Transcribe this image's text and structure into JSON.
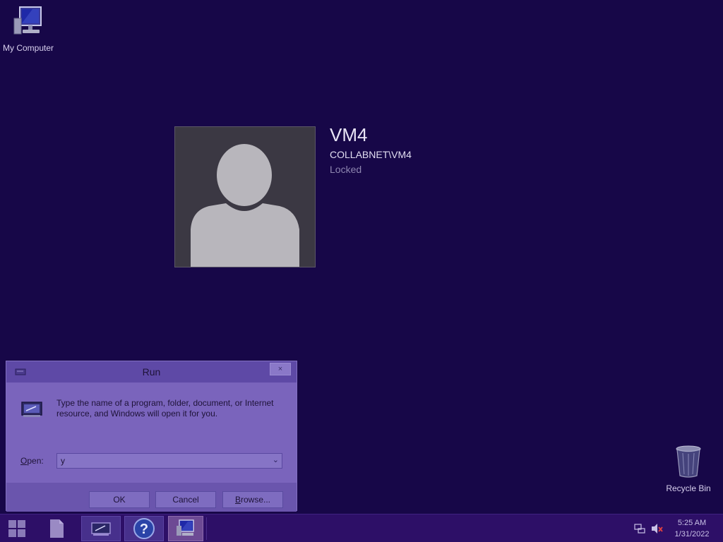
{
  "desktop": {
    "icons": [
      {
        "label": "My Computer",
        "icon": "computer-icon"
      },
      {
        "label": "Recycle Bin",
        "icon": "recycle-bin-icon"
      }
    ]
  },
  "lock_screen": {
    "user_name": "VM4",
    "account": "COLLABNET\\VM4",
    "status": "Locked",
    "avatar_icon": "user-silhouette-icon"
  },
  "run_dialog": {
    "title": "Run",
    "close_label": "×",
    "description": "Type the name of a program, folder, document, or Internet resource, and Windows will open it for you.",
    "open_label_accel": "O",
    "open_label_rest": "pen:",
    "open_value": "y",
    "buttons": {
      "ok": "OK",
      "cancel": "Cancel",
      "browse_accel": "B",
      "browse_rest": "rowse..."
    }
  },
  "taskbar": {
    "items": [
      "start-icon",
      "file-icon",
      "run-app-icon",
      "help-icon",
      "explorer-icon"
    ],
    "tray": [
      "network-icon",
      "volume-muted-icon"
    ],
    "clock": {
      "time": "5:25 AM",
      "date": "1/31/2022"
    }
  },
  "colors": {
    "desktop_bg": "#170748",
    "taskbar_bg": "#2d0f67",
    "dialog_bg": "#7a64bc"
  }
}
